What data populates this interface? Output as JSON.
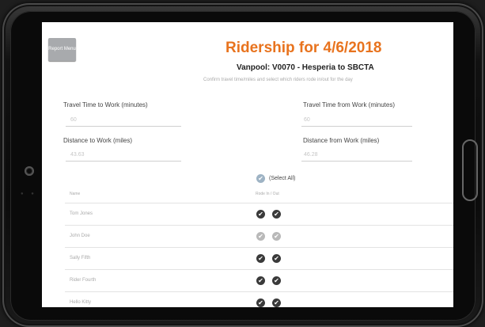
{
  "screen": {
    "report_menu_label": "Report Menu",
    "title": "Ridership for 4/6/2018",
    "subtitle": "Vanpool: V0070 - Hesperia to SBCTA",
    "instructions": "Confirm travel time/miles and select which riders rode in/out for the day"
  },
  "fields": {
    "travel_time_to_work": {
      "label": "Travel Time to Work (minutes)",
      "value": "60"
    },
    "travel_time_from_work": {
      "label": "Travel Time from Work (minutes)",
      "value": "60"
    },
    "distance_to_work": {
      "label": "Distance to Work (miles)",
      "value": "43.63"
    },
    "distance_from_work": {
      "label": "Distance from Work (miles)",
      "value": "46.28"
    }
  },
  "select_all": {
    "label": "(Select All)",
    "checked": true
  },
  "table": {
    "headers": {
      "name": "Name",
      "rode": "Rode In / Out"
    },
    "rows": [
      {
        "name": "Tom Jones",
        "rode_in": true,
        "rode_out": true
      },
      {
        "name": "John Doe",
        "rode_in": false,
        "rode_out": false
      },
      {
        "name": "Sally Fifth",
        "rode_in": true,
        "rode_out": true
      },
      {
        "name": "Rider Fourth",
        "rode_in": true,
        "rode_out": true
      },
      {
        "name": "Hello Kitty",
        "rode_in": true,
        "rode_out": true
      }
    ]
  },
  "colors": {
    "title": "#e8731e",
    "checked": "#3a3a3a",
    "unchecked": "#b9b9b9",
    "report_menu_bg": "#a8aaad"
  }
}
